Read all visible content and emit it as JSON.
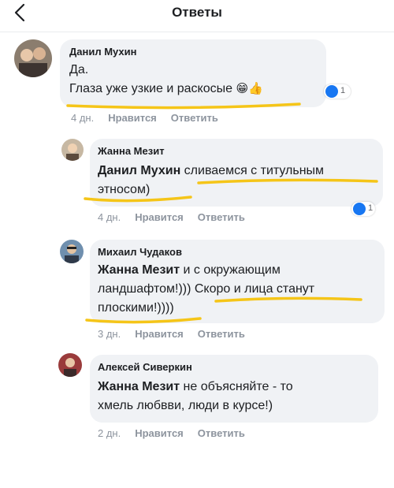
{
  "header": {
    "title": "Ответы"
  },
  "comments": [
    {
      "author": "Данил Мухин",
      "lines": [
        "Да.",
        "Глаза уже узкие и раскосые"
      ],
      "emoji": "😁👍",
      "reactions": "1",
      "time": "4 дн.",
      "like": "Нравится",
      "reply": "Ответить"
    },
    {
      "author": "Жанна Мезит",
      "mention": "Данил Мухин",
      "line1_rest": " сливаемся с титульным",
      "line2": "этносом)",
      "reactions": "1",
      "time": "4 дн.",
      "like": "Нравится",
      "reply": "Ответить"
    },
    {
      "author": "Михаил Чудаков",
      "mention": "Жанна Мезит",
      "line1_rest": " и с окружающим",
      "line2": "ландшафтом!))) Скоро и лица станут",
      "line3": "плоскими!))))",
      "time": "3 дн.",
      "like": "Нравится",
      "reply": "Ответить"
    },
    {
      "author": "Алексей Сиверкин",
      "mention": "Жанна Мезит",
      "line1_rest": " не объясняйте - то",
      "line2": "хмель любвви, люди в курсе!)",
      "time": "2 дн.",
      "like": "Нравится",
      "reply": "Ответить"
    }
  ],
  "colors": {
    "highlight": "#f5c518",
    "bubble": "#f0f2f5",
    "meta": "#8d949e",
    "like_blue": "#1877f2"
  }
}
